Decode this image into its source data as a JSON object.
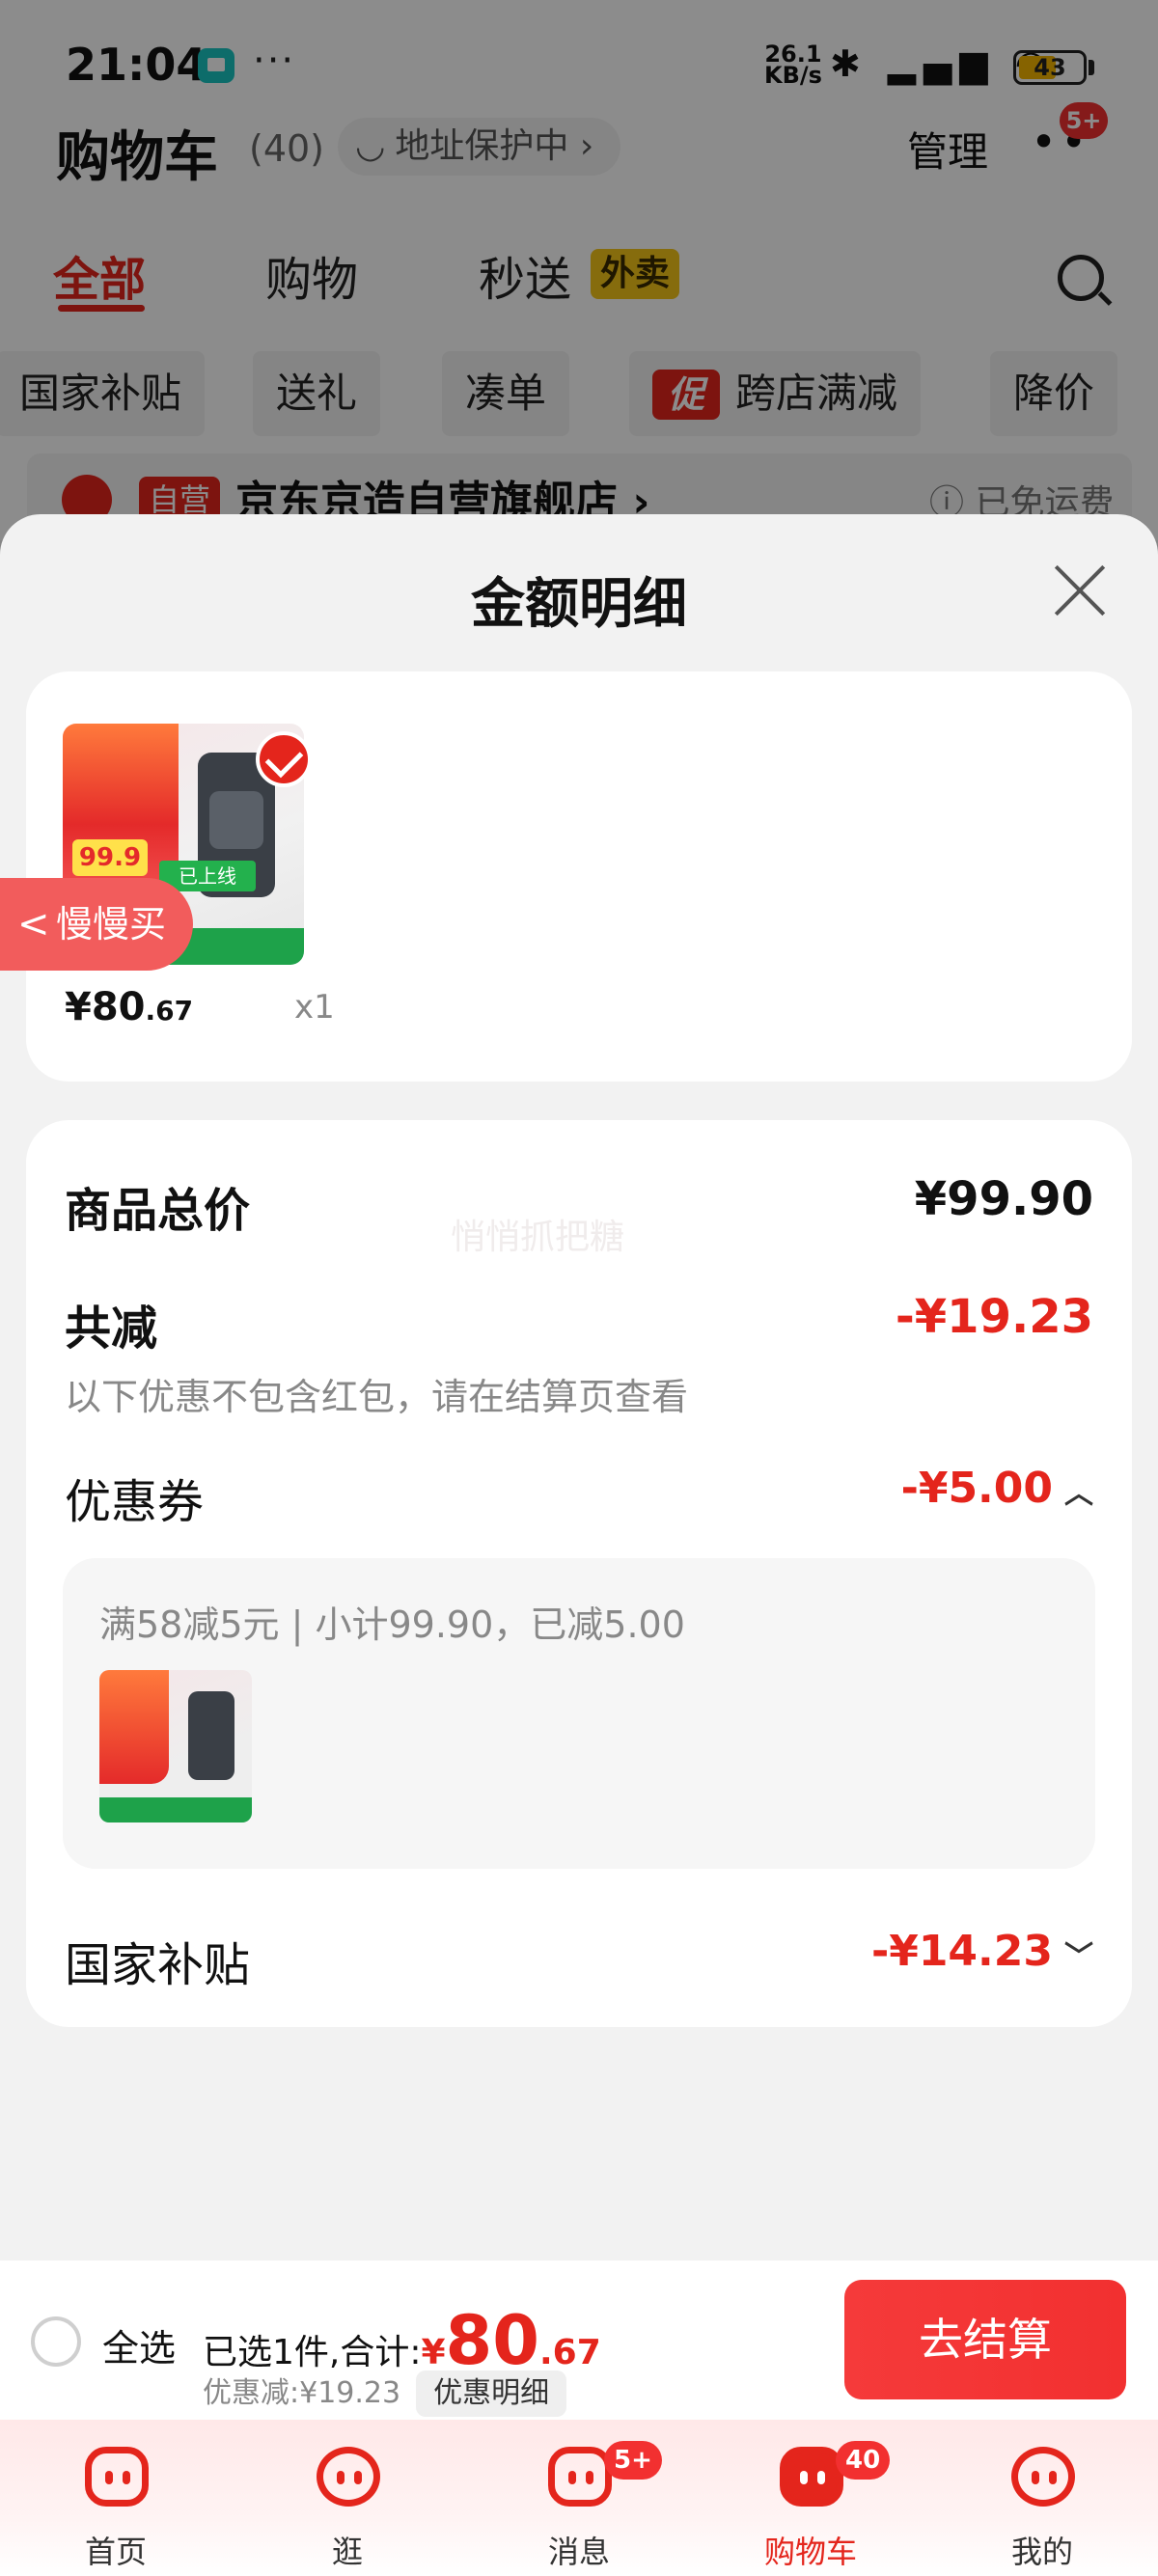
{
  "status_bar": {
    "time": "21:04",
    "net_speed": "26.1",
    "net_unit": "KB/s",
    "battery": "43",
    "more": "···"
  },
  "header": {
    "title": "购物车",
    "count": "(40)",
    "address": "地址保护中",
    "address_arrow": "›",
    "manage": "管理",
    "more_badge": "5+"
  },
  "tabs": [
    {
      "label": "全部",
      "active": true
    },
    {
      "label": "购物"
    },
    {
      "label": "秒送"
    }
  ],
  "tab_badge": "外卖",
  "chips": [
    "国家补贴",
    "送礼",
    "凑单",
    "跨店满减",
    "降价"
  ],
  "chip_promo": "促",
  "store": {
    "tag": "自营",
    "name": "京东京造自营旗舰店 ›",
    "shipping": "ⓘ 已免运费"
  },
  "sheet": {
    "title": "金额明细",
    "item": {
      "price_main": "¥80",
      "price_decimal": ".67",
      "qty": "x1",
      "thumb_tag": "99.9",
      "thumb_label": "已上线"
    },
    "slow_buy": "慢慢买",
    "watermark": "悄悄抓把糖",
    "rows": {
      "total_label": "商品总价",
      "total_value": "¥99.90",
      "discount_label": "共减",
      "discount_value": "-¥19.23",
      "discount_note": "以下优惠不包含红包，请在结算页查看",
      "coupon_label": "优惠券",
      "coupon_value": "-¥5.00",
      "coupon_detail": "满58减5元 | 小计99.90，已减5.00",
      "subsidy_label": "国家补贴",
      "subsidy_value": "-¥14.23"
    }
  },
  "checkout": {
    "select_all": "全选",
    "selected_prefix": "已选1件,合计:",
    "yen": "¥",
    "total_int": "80",
    "total_dec": ".67",
    "savings": "优惠减:¥19.23",
    "detail_button": "优惠明细",
    "checkout_button": "去结算"
  },
  "tabbar": {
    "items": [
      {
        "label": "首页",
        "icon": "home-icon"
      },
      {
        "label": "逛",
        "icon": "browse-icon"
      },
      {
        "label": "消息",
        "icon": "message-icon",
        "badge": "5+"
      },
      {
        "label": "购物车",
        "icon": "cart-icon",
        "badge": "40",
        "active": true
      },
      {
        "label": "我的",
        "icon": "profile-icon"
      }
    ]
  },
  "colors": {
    "accent_red": "#e4251c",
    "badge_yellow": "#f5c518",
    "dim_overlay": "rgba(0,0,0,0.45)"
  }
}
